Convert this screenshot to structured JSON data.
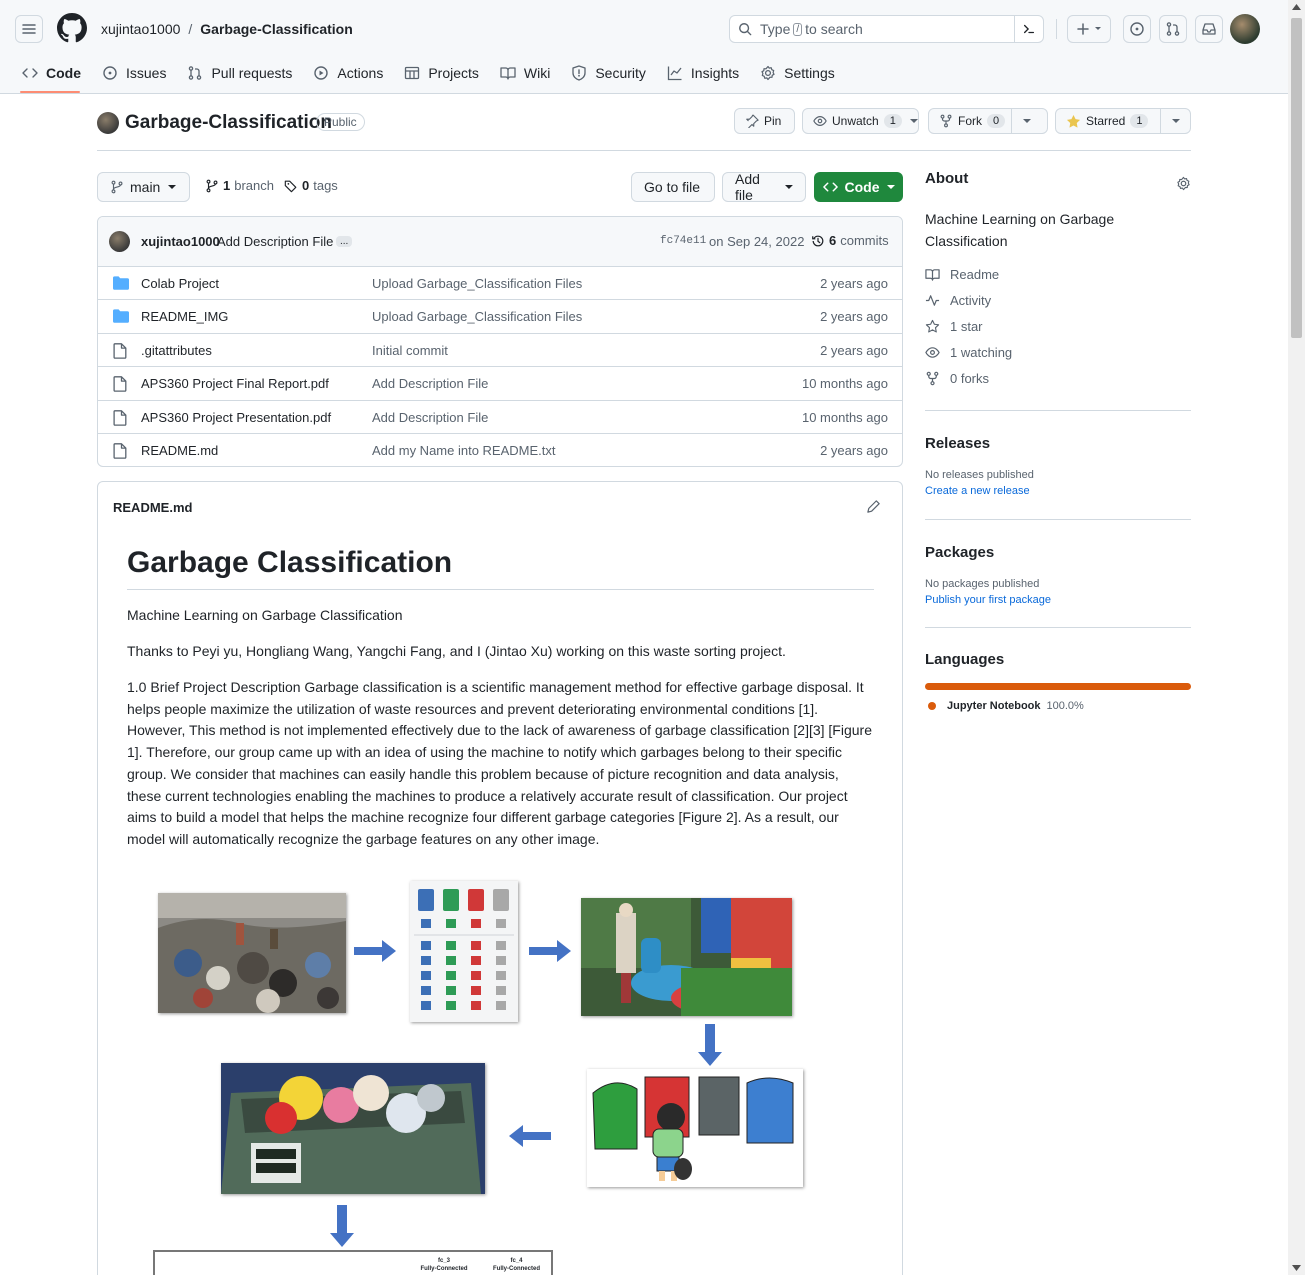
{
  "header": {
    "owner": "xujintao1000",
    "repo": "Garbage-Classification",
    "search_prefix": "Type",
    "search_key": "/",
    "search_suffix": "to search"
  },
  "tabs": [
    {
      "label": "Code",
      "icon": "code-icon"
    },
    {
      "label": "Issues",
      "icon": "issue-icon"
    },
    {
      "label": "Pull requests",
      "icon": "pull-request-icon"
    },
    {
      "label": "Actions",
      "icon": "play-icon"
    },
    {
      "label": "Projects",
      "icon": "table-icon"
    },
    {
      "label": "Wiki",
      "icon": "book-icon"
    },
    {
      "label": "Security",
      "icon": "shield-icon"
    },
    {
      "label": "Insights",
      "icon": "graph-icon"
    },
    {
      "label": "Settings",
      "icon": "gear-icon"
    }
  ],
  "repo": {
    "name": "Garbage-Classification",
    "visibility": "Public",
    "pin": "Pin",
    "unwatch": "Unwatch",
    "watch_count": "1",
    "fork": "Fork",
    "fork_count": "0",
    "starred": "Starred",
    "star_count": "1"
  },
  "filenav": {
    "branch": "main",
    "branch_count": "1",
    "branch_word": "branch",
    "tag_count": "0",
    "tag_word": "tags",
    "goto": "Go to file",
    "addfile": "Add file",
    "code": "Code"
  },
  "commit": {
    "author": "xujintao1000",
    "message": "Add Description File",
    "ellipsis": "...",
    "sha": "fc74e11",
    "date": "on Sep 24, 2022",
    "count": "6",
    "count_word": "commits"
  },
  "files": [
    {
      "name": "Colab Project",
      "type": "folder",
      "message": "Upload Garbage_Classification Files",
      "age": "2 years ago"
    },
    {
      "name": "README_IMG",
      "type": "folder",
      "message": "Upload Garbage_Classification Files",
      "age": "2 years ago"
    },
    {
      "name": ".gitattributes",
      "type": "file",
      "message": "Initial commit",
      "age": "2 years ago"
    },
    {
      "name": "APS360 Project Final Report.pdf",
      "type": "file",
      "message": "Add Description File",
      "age": "10 months ago"
    },
    {
      "name": "APS360 Project Presentation.pdf",
      "type": "file",
      "message": "Add Description File",
      "age": "10 months ago"
    },
    {
      "name": "README.md",
      "type": "file",
      "message": "Add my Name into README.txt",
      "age": "2 years ago"
    }
  ],
  "readme": {
    "filename": "README.md",
    "title": "Garbage Classification",
    "p1": "Machine Learning on Garbage Classification",
    "p2": "Thanks to Peyi yu, Hongliang Wang, Yangchi Fang, and I (Jintao Xu) working on this waste sorting project.",
    "p3": "1.0 Brief Project Description Garbage classification is a scientific management method for effective garbage disposal. It helps people maximize the utilization of waste resources and prevent deteriorating environmental conditions [1]. However, This method is not implemented effectively due to the lack of awareness of garbage classification [2][3] [Figure 1]. Therefore, our group came up with an idea of using the machine to notify which garbages belong to their specific group. We consider that machines can easily handle this problem because of picture recognition and data analysis, these current technologies enabling the machines to produce a relatively accurate result of classification. Our project aims to build a model that helps the machine recognize four different garbage categories [Figure 2]. As a result, our model will automatically recognize the garbage features on any other image.",
    "fig_labels": [
      "fc_3",
      "Fully-Connected",
      "fc_4",
      "Fully-Connected"
    ]
  },
  "about": {
    "heading": "About",
    "description": "Machine Learning on Garbage Classification",
    "readme": "Readme",
    "activity": "Activity",
    "stars": "1 star",
    "watching": "1 watching",
    "forks": "0 forks"
  },
  "releases": {
    "heading": "Releases",
    "none": "No releases published",
    "create": "Create a new release"
  },
  "packages": {
    "heading": "Packages",
    "none": "No packages published",
    "publish": "Publish your first package"
  },
  "languages": {
    "heading": "Languages",
    "name": "Jupyter Notebook",
    "percent": "100.0%",
    "percent_value": 100,
    "color": "#da5b0b"
  }
}
